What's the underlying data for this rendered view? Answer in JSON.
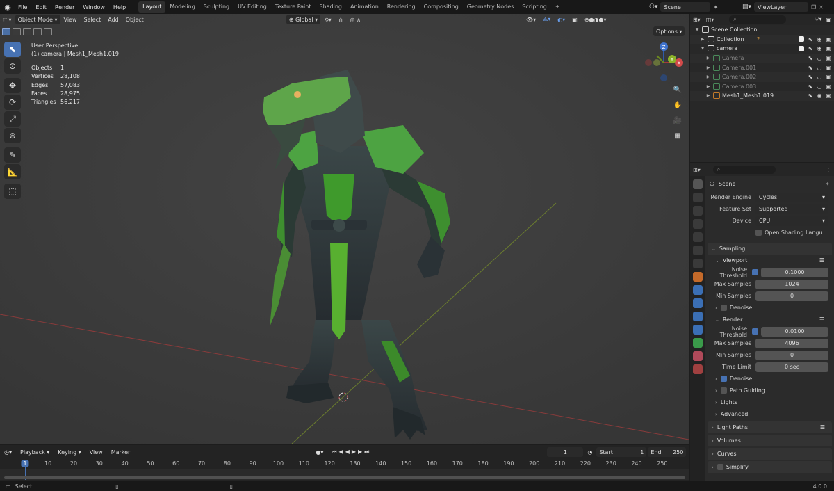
{
  "menu": [
    "File",
    "Edit",
    "Render",
    "Window",
    "Help"
  ],
  "workspaces": [
    "Layout",
    "Modeling",
    "Sculpting",
    "UV Editing",
    "Texture Paint",
    "Shading",
    "Animation",
    "Rendering",
    "Compositing",
    "Geometry Nodes",
    "Scripting"
  ],
  "active_workspace": "Layout",
  "scene_name": "Scene",
  "view_layer": "ViewLayer",
  "viewport": {
    "mode": "Object Mode",
    "menus": [
      "View",
      "Select",
      "Add",
      "Object"
    ],
    "orientation": "Global",
    "options_label": "Options",
    "perspective": "User Perspective",
    "active_object": "(1) camera | Mesh1_Mesh1.019",
    "stats": [
      {
        "k": "Objects",
        "v": "1"
      },
      {
        "k": "Vertices",
        "v": "28,108"
      },
      {
        "k": "Edges",
        "v": "57,083"
      },
      {
        "k": "Faces",
        "v": "28,975"
      },
      {
        "k": "Triangles",
        "v": "56,217"
      }
    ],
    "gizmo": {
      "z": "Z",
      "x": "X",
      "y": "Y"
    }
  },
  "timeline": {
    "menus": [
      "Playback",
      "Keying",
      "View",
      "Marker"
    ],
    "current_frame": "1",
    "start_label": "Start",
    "start": "1",
    "end_label": "End",
    "end": "250",
    "ruler": [
      "1",
      "10",
      "20",
      "30",
      "40",
      "50",
      "60",
      "70",
      "80",
      "90",
      "100",
      "110",
      "120",
      "130",
      "140",
      "150",
      "160",
      "170",
      "180",
      "190",
      "200",
      "210",
      "220",
      "230",
      "240",
      "250"
    ]
  },
  "status": {
    "left": "Select",
    "version": "4.0.0"
  },
  "outliner": {
    "rows": [
      {
        "label": "Scene Collection",
        "indent": 0
      },
      {
        "label": "Collection",
        "indent": 1,
        "badge": "2"
      },
      {
        "label": "camera",
        "indent": 1
      },
      {
        "label": "Camera",
        "indent": 2,
        "dim": true
      },
      {
        "label": "Camera.001",
        "indent": 2,
        "dim": true
      },
      {
        "label": "Camera.002",
        "indent": 2,
        "dim": true
      },
      {
        "label": "Camera.003",
        "indent": 2,
        "dim": true
      },
      {
        "label": "Mesh1_Mesh1.019",
        "indent": 2
      }
    ]
  },
  "properties": {
    "context": "Scene",
    "render_engine_label": "Render Engine",
    "render_engine": "Cycles",
    "feature_set_label": "Feature Set",
    "feature_set": "Supported",
    "device_label": "Device",
    "device": "CPU",
    "osl_label": "Open Shading Langu...",
    "sampling": "Sampling",
    "viewport": "Viewport",
    "noise_threshold_label": "Noise Threshold",
    "vp_noise": "0.1000",
    "max_samples_label": "Max Samples",
    "vp_max": "1024",
    "min_samples_label": "Min Samples",
    "vp_min": "0",
    "denoise": "Denoise",
    "render": "Render",
    "r_noise": "0.0100",
    "r_max": "4096",
    "r_min": "0",
    "time_limit_label": "Time Limit",
    "r_time": "0 sec",
    "path_guiding": "Path Guiding",
    "lights": "Lights",
    "advanced": "Advanced",
    "light_paths": "Light Paths",
    "volumes": "Volumes",
    "curves": "Curves",
    "simplify": "Simplify"
  }
}
